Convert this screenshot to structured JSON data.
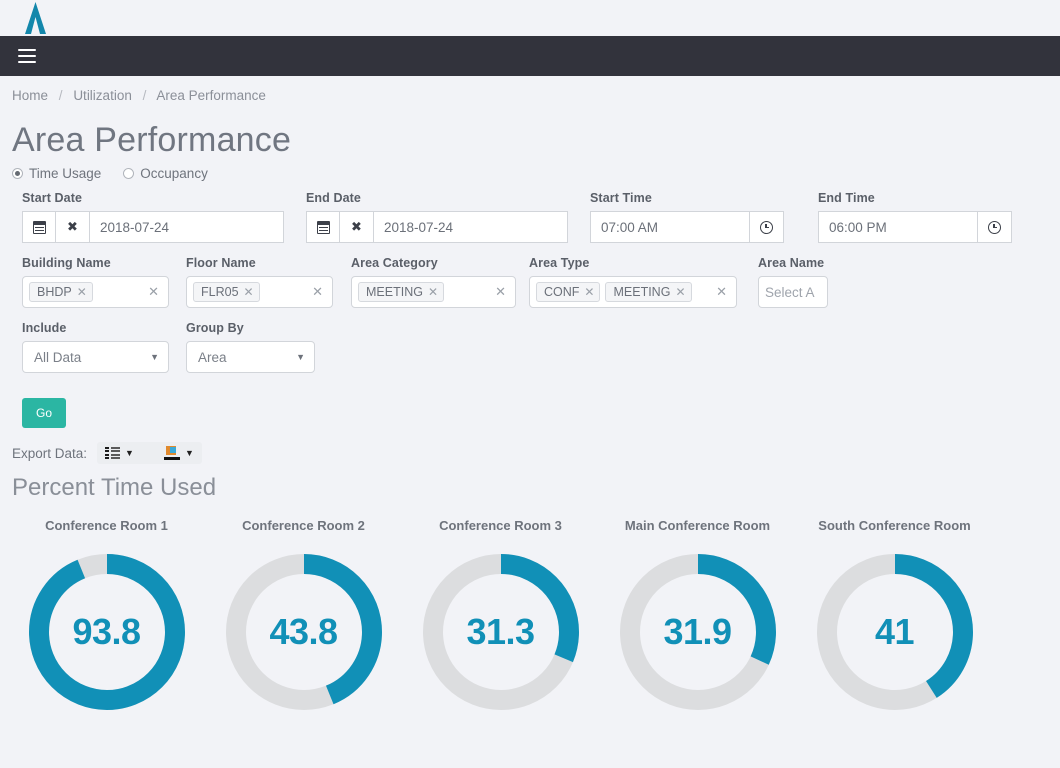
{
  "brand": {
    "logo_icon": "lambda-logo-icon",
    "logo_color": "#1387ab",
    "navbar_color": "#32333c",
    "accent_color": "#1190b7",
    "go_button_color": "#2bb6a3"
  },
  "navbar": {
    "menu_icon": "hamburger-menu-icon"
  },
  "breadcrumb": {
    "home": "Home",
    "section": "Utilization",
    "current": "Area Performance",
    "separator": "/"
  },
  "page": {
    "title": "Area Performance"
  },
  "mode_options": [
    {
      "label": "Time Usage",
      "selected": true
    },
    {
      "label": "Occupancy",
      "selected": false
    }
  ],
  "filters": {
    "start_date": {
      "label": "Start Date",
      "value": "2018-07-24",
      "calendar_icon": "calendar-icon",
      "clear_icon": "clear-x-icon"
    },
    "end_date": {
      "label": "End Date",
      "value": "2018-07-24",
      "calendar_icon": "calendar-icon",
      "clear_icon": "clear-x-icon"
    },
    "start_time": {
      "label": "Start Time",
      "value": "07:00 AM",
      "clock_icon": "clock-icon"
    },
    "end_time": {
      "label": "End Time",
      "value": "06:00 PM",
      "clock_icon": "clock-icon"
    },
    "building_name": {
      "label": "Building Name",
      "tags": [
        "BHDP"
      ],
      "clear_icon": "clear-x-icon"
    },
    "floor_name": {
      "label": "Floor Name",
      "tags": [
        "FLR05"
      ],
      "clear_icon": "clear-x-icon"
    },
    "area_category": {
      "label": "Area Category",
      "tags": [
        "MEETING"
      ],
      "clear_icon": "clear-x-icon"
    },
    "area_type": {
      "label": "Area Type",
      "tags": [
        "CONF",
        "MEETING"
      ],
      "clear_icon": "clear-x-icon"
    },
    "area_name": {
      "label": "Area Name",
      "placeholder": "Select A"
    },
    "include": {
      "label": "Include",
      "value": "All Data",
      "caret_icon": "chevron-down-icon"
    },
    "group_by": {
      "label": "Group By",
      "value": "Area",
      "caret_icon": "chevron-down-icon"
    }
  },
  "actions": {
    "go_label": "Go"
  },
  "export": {
    "label": "Export Data:",
    "list_icon": "export-list-icon",
    "image_icon": "export-image-icon",
    "caret_icon": "caret-down-icon"
  },
  "chart_data": {
    "type": "pie",
    "title": "Percent Time Used",
    "unit": "%",
    "max": 100,
    "donut": true,
    "start_angle": 0,
    "direction": "clockwise",
    "value_color": "#1190b7",
    "track_color": "#dcdddf",
    "categories": [
      "Conference Room 1",
      "Conference Room 2",
      "Conference Room 3",
      "Main Conference Room",
      "South Conference Room"
    ],
    "values": [
      93.8,
      43.8,
      31.3,
      31.9,
      41
    ],
    "labels": [
      "93.8",
      "43.8",
      "31.3",
      "31.9",
      "41"
    ],
    "xlabel": "",
    "ylabel": "Percent Time Used",
    "legend": "none"
  }
}
